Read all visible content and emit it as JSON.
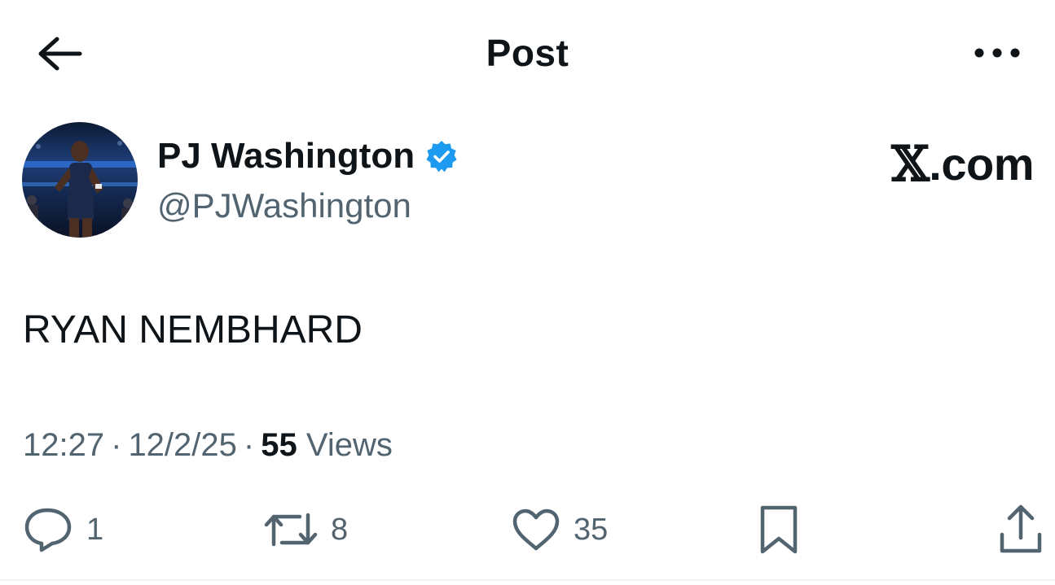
{
  "header": {
    "title": "Post",
    "back_icon": "arrow-left-icon",
    "more_icon": "more-horizontal-icon"
  },
  "author": {
    "display_name": "PJ Washington",
    "handle": "@PJWashington",
    "verified": true,
    "badge_color": "#1d9bf0"
  },
  "brand": {
    "x_glyph": "𝕏",
    "suffix": ".com"
  },
  "post": {
    "text": "RYAN NEMBHARD"
  },
  "meta": {
    "time": "12:27",
    "separator": "·",
    "date": "12/2/25",
    "views_count": "55",
    "views_label": "Views"
  },
  "actions": {
    "replies": "1",
    "reposts": "8",
    "likes": "35"
  },
  "colors": {
    "text_primary": "#0f1419",
    "text_secondary": "#536471",
    "accent": "#1d9bf0"
  }
}
